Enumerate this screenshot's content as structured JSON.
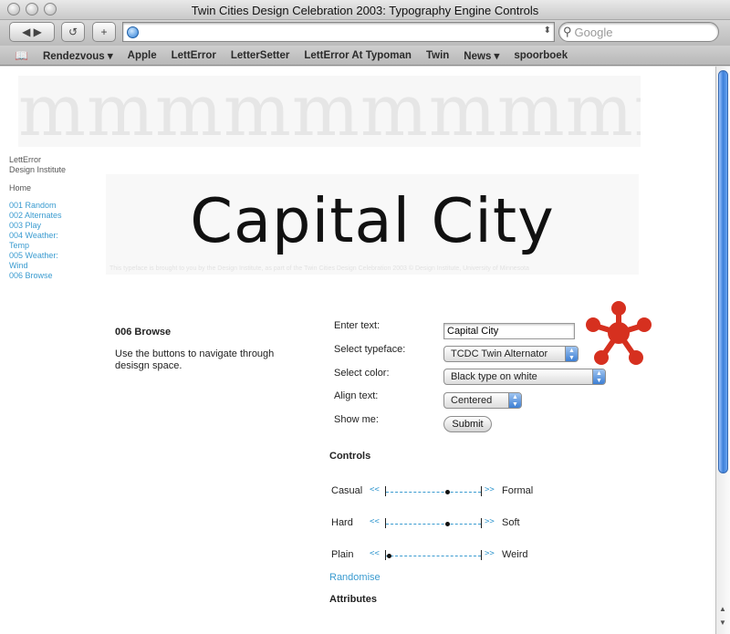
{
  "window": {
    "title": "Twin Cities Design Celebration 2003: Typography Engine Controls"
  },
  "toolbar": {
    "back_forward_glyph": "◀ ▶",
    "reload_glyph": "↺",
    "add_glyph": "+",
    "address": "",
    "search_placeholder": "Google"
  },
  "bookmarks": [
    "Rendezvous ▾",
    "Apple",
    "LettError",
    "LetterSetter",
    "LettError At Typoman",
    "Twin",
    "News ▾",
    "spoorboek"
  ],
  "page": {
    "banner_letters": "mmmmmmmmmmmm",
    "nav": {
      "brand_line1": "LettError",
      "brand_line2": "Design Institute",
      "home": "Home",
      "links": [
        "001 Random",
        "002 Alternates",
        "003 Play",
        "004 Weather:",
        "Temp",
        "005 Weather:",
        "Wind",
        "006 Browse"
      ]
    },
    "hero": {
      "text": "Capital City",
      "credit": "This typeface is brought to you by the Design Institute, as part of the Twin Cities Design Celebration 2003 © Design Institute, University of Minnesota"
    },
    "section": {
      "title": "006 Browse",
      "desc": "Use the buttons to navigate through desisgn space."
    },
    "form": {
      "enter_text_label": "Enter text:",
      "text_value": "Capital City",
      "typeface_label": "Select typeface:",
      "typeface_value": "TCDC Twin Alternator",
      "color_label": "Select color:",
      "color_value": "Black type on white",
      "align_label": "Align text:",
      "align_value": "Centered",
      "show_label": "Show me:",
      "submit": "Submit"
    },
    "controls": {
      "heading": "Controls",
      "sliders": [
        {
          "left": "Casual",
          "right": "Formal",
          "value": 0.66
        },
        {
          "left": "Hard",
          "right": "Soft",
          "value": 0.66
        },
        {
          "left": "Plain",
          "right": "Weird",
          "value": 0.03
        }
      ],
      "nav_left": "<<",
      "nav_right": ">>",
      "randomise": "Randomise"
    },
    "attributes": {
      "heading": "Attributes"
    }
  },
  "colors": {
    "link": "#3a9bd0",
    "asterisk": "#d6301f"
  }
}
